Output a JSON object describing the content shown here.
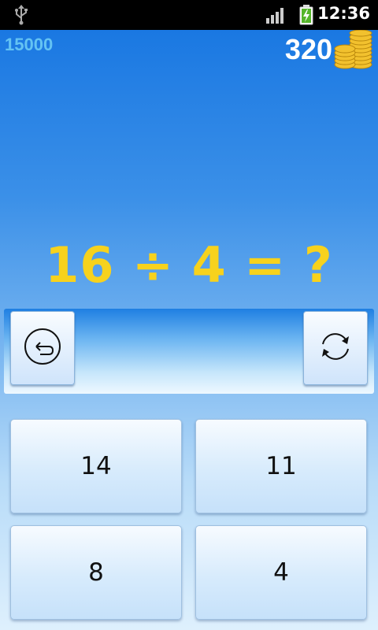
{
  "status_bar": {
    "time": "12:36",
    "icons": [
      "usb-icon",
      "signal-icon",
      "battery-charging-icon"
    ]
  },
  "header": {
    "score": "15000",
    "coins": "320",
    "coins_icon": "coin-stack-icon"
  },
  "question": {
    "text": "16 ÷ 4 = ?"
  },
  "answer_panel": {
    "back_icon": "back-arrow-icon",
    "refresh_icon": "refresh-icon"
  },
  "choices": [
    "14",
    "11",
    "8",
    "4"
  ],
  "colors": {
    "question": "#f7d21d",
    "score": "#64c3f3",
    "background_top": "#1a78e2",
    "background_bottom": "#def0fd"
  }
}
